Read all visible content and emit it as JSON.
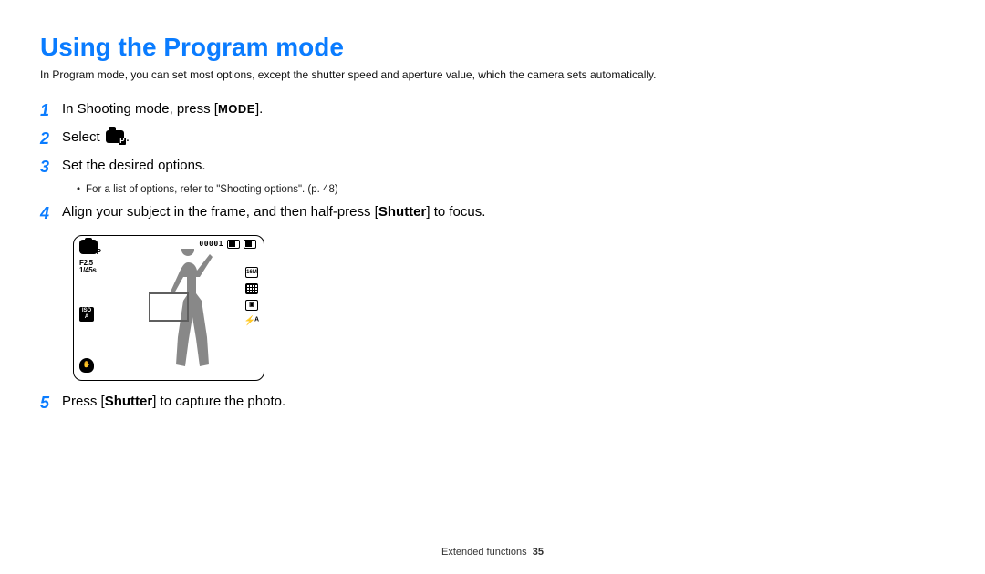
{
  "title": "Using the Program mode",
  "intro": "In Program mode, you can set most options, except the shutter speed and aperture value, which the camera sets automatically.",
  "steps": {
    "s1_pre": "In Shooting mode, press [",
    "s1_btn": "MODE",
    "s1_post": "].",
    "s2_pre": "Select ",
    "s2_post": ".",
    "s3": "Set the desired options.",
    "s3_sub": "For a list of options, refer to \"Shooting options\". (p. 48)",
    "s4_pre": "Align your subject in the frame, and then half-press [",
    "s4_shutter": "Shutter",
    "s4_post": "] to focus.",
    "s5_pre": "Press [",
    "s5_shutter": "Shutter",
    "s5_post": "] to capture the photo."
  },
  "numbers": {
    "n1": "1",
    "n2": "2",
    "n3": "3",
    "n4": "4",
    "n5": "5"
  },
  "screen": {
    "counter": "00001",
    "aperture": "F2.5",
    "shutter_row": "1/45s",
    "iso_top": "ISO",
    "iso_bot": "A",
    "size_badge": "16M",
    "flash": "⚡ᴬ"
  },
  "footer": {
    "section": "Extended functions",
    "page": "35"
  }
}
